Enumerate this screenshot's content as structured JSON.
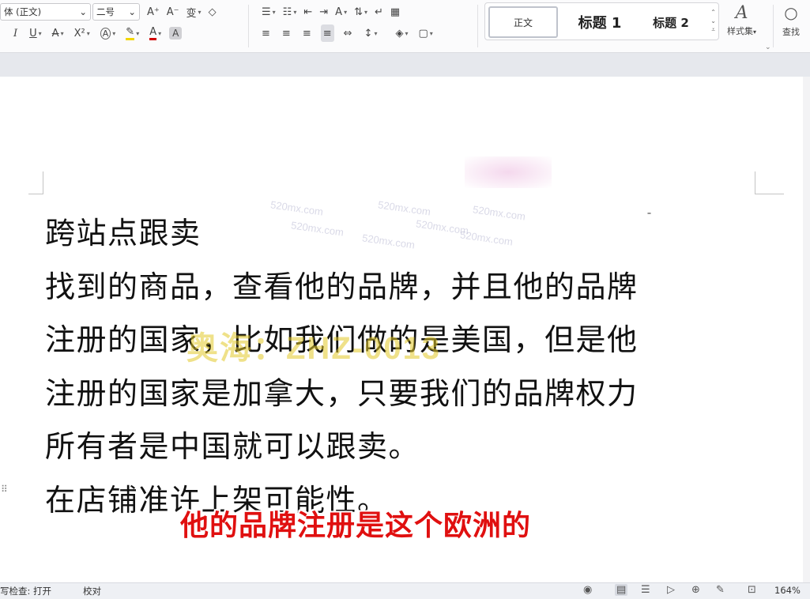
{
  "toolbar": {
    "font_name": "体 (正文)",
    "font_size": "二号",
    "grow_font": "A⁺",
    "shrink_font": "A⁻",
    "phonetic": "变",
    "clear_format": "◇",
    "italic": "I",
    "underline": "U",
    "strikethrough": "A",
    "superscript": "X²",
    "text_effect": "A",
    "highlight": "✎",
    "font_color": "A",
    "char_shading": "A",
    "bullets": "☰",
    "numbering": "☷",
    "outdent": "⇤",
    "indent": "⇥",
    "char_scale": "A",
    "sort": "⇅",
    "show_marks": "↵",
    "table_icon": "▦",
    "align_left": "≡",
    "align_center": "≡",
    "align_right": "≡",
    "justify": "≡",
    "distributed": "⇔",
    "line_spacing": "↕",
    "shading": "◈",
    "borders": "▢",
    "style_normal": "正文",
    "style_h1": "标题 1",
    "style_h2": "标题 2",
    "style_set_label": "样式集",
    "find_label": "查找"
  },
  "document": {
    "lines": [
      "跨站点跟卖",
      "找到的商品，查看他的品牌，并且他的品牌",
      "注册的国家，比如我们做的是美国，但是他",
      "注册的国家是加拿大，只要我们的品牌权力",
      "所有者是中国就可以跟卖。",
      "在店铺准许上架可能性。"
    ]
  },
  "overlay": {
    "watermark_id": "奥海：ZHZ-0013",
    "watermark_site": "520mx.com",
    "subtitle": "他的品牌注册是这个欧洲的"
  },
  "statusbar": {
    "spell_check": "写检查: 打开",
    "proofread": "校对",
    "zoom": "164%"
  }
}
